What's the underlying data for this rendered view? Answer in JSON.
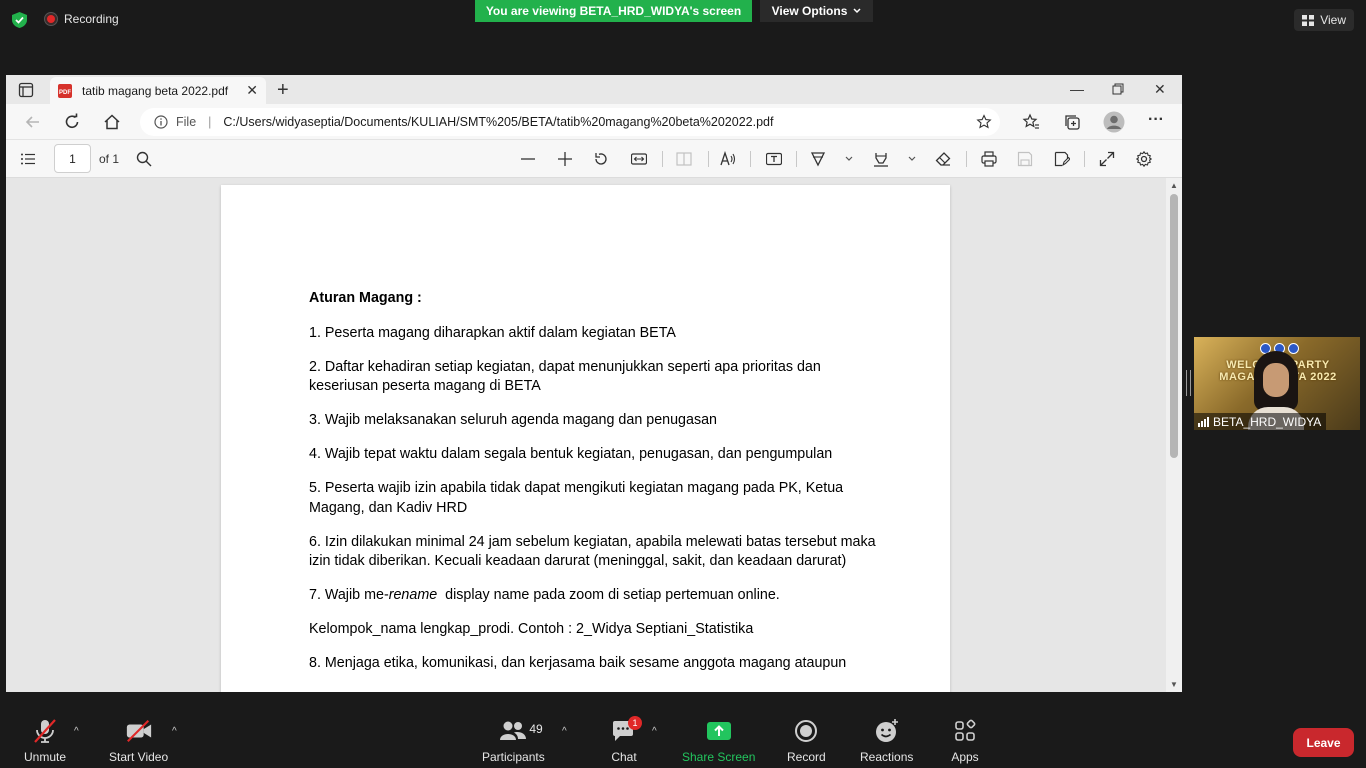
{
  "zoom_top": {
    "recording_label": "Recording",
    "viewing_banner": "You are viewing BETA_HRD_WIDYA's screen",
    "view_options_label": "View Options",
    "view_label": "View",
    "colors": {
      "banner_green": "#22b14c",
      "shield_green": "#22b14c"
    }
  },
  "edge": {
    "tab_title": "tatib magang beta 2022.pdf",
    "address_prefix": "File",
    "address_url": "C:/Users/widyaseptia/Documents/KULIAH/SMT%205/BETA/tatib%20magang%20beta%202022.pdf",
    "pdf_toolbar": {
      "page_value": "1",
      "page_of": "of 1"
    }
  },
  "document": {
    "heading": "Aturan Magang :",
    "items": [
      "1. Peserta magang diharapkan aktif dalam kegiatan BETA",
      "2. Daftar kehadiran setiap kegiatan, dapat menunjukkan seperti apa prioritas dan keseriusan peserta magang di BETA",
      "3. Wajib melaksanakan seluruh agenda magang dan penugasan",
      "4. Wajib tepat waktu dalam segala bentuk kegiatan, penugasan, dan pengumpulan",
      "5. Peserta wajib izin apabila tidak dapat mengikuti kegiatan magang pada PK, Ketua Magang, dan Kadiv HRD",
      "6. Izin dilakukan minimal 24 jam sebelum kegiatan, apabila melewati batas tersebut maka izin tidak diberikan. Kecuali keadaan darurat (meninggal, sakit, dan keadaan darurat)"
    ],
    "item7_prefix": "7. Wajib me-",
    "item7_italic": "rename",
    "item7_suffix": "  display name pada zoom di setiap pertemuan online.",
    "format_line": "Kelompok_nama lengkap_prodi. Contoh : 2_Widya Septiani_Statistika",
    "item8": "8. Menjaga etika, komunikasi, dan kerjasama baik sesame anggota magang ataupun"
  },
  "video_tile": {
    "participant_name": "BETA_HRD_WIDYA",
    "background_text_line1": "WELCOME PARTY",
    "background_text_line2": "MAGANG BETA 2022"
  },
  "bottom_bar": {
    "unmute": "Unmute",
    "start_video": "Start Video",
    "participants": "Participants",
    "participants_count": "49",
    "chat": "Chat",
    "chat_badge": "1",
    "share_screen": "Share Screen",
    "record": "Record",
    "reactions": "Reactions",
    "apps": "Apps",
    "leave": "Leave",
    "colors": {
      "share_green": "#22c55e",
      "leave_red": "#c9282d",
      "badge_red": "#e02828"
    }
  }
}
